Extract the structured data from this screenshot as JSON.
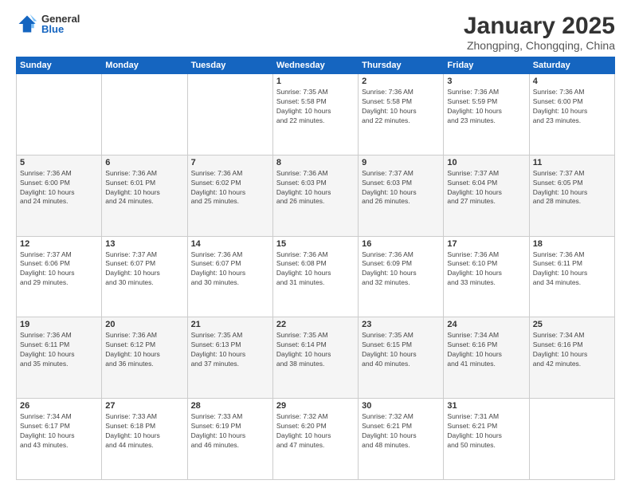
{
  "logo": {
    "general": "General",
    "blue": "Blue"
  },
  "title": "January 2025",
  "subtitle": "Zhongping, Chongqing, China",
  "days_of_week": [
    "Sunday",
    "Monday",
    "Tuesday",
    "Wednesday",
    "Thursday",
    "Friday",
    "Saturday"
  ],
  "weeks": [
    [
      {
        "day": "",
        "info": ""
      },
      {
        "day": "",
        "info": ""
      },
      {
        "day": "",
        "info": ""
      },
      {
        "day": "1",
        "info": "Sunrise: 7:35 AM\nSunset: 5:58 PM\nDaylight: 10 hours\nand 22 minutes."
      },
      {
        "day": "2",
        "info": "Sunrise: 7:36 AM\nSunset: 5:58 PM\nDaylight: 10 hours\nand 22 minutes."
      },
      {
        "day": "3",
        "info": "Sunrise: 7:36 AM\nSunset: 5:59 PM\nDaylight: 10 hours\nand 23 minutes."
      },
      {
        "day": "4",
        "info": "Sunrise: 7:36 AM\nSunset: 6:00 PM\nDaylight: 10 hours\nand 23 minutes."
      }
    ],
    [
      {
        "day": "5",
        "info": "Sunrise: 7:36 AM\nSunset: 6:00 PM\nDaylight: 10 hours\nand 24 minutes."
      },
      {
        "day": "6",
        "info": "Sunrise: 7:36 AM\nSunset: 6:01 PM\nDaylight: 10 hours\nand 24 minutes."
      },
      {
        "day": "7",
        "info": "Sunrise: 7:36 AM\nSunset: 6:02 PM\nDaylight: 10 hours\nand 25 minutes."
      },
      {
        "day": "8",
        "info": "Sunrise: 7:36 AM\nSunset: 6:03 PM\nDaylight: 10 hours\nand 26 minutes."
      },
      {
        "day": "9",
        "info": "Sunrise: 7:37 AM\nSunset: 6:03 PM\nDaylight: 10 hours\nand 26 minutes."
      },
      {
        "day": "10",
        "info": "Sunrise: 7:37 AM\nSunset: 6:04 PM\nDaylight: 10 hours\nand 27 minutes."
      },
      {
        "day": "11",
        "info": "Sunrise: 7:37 AM\nSunset: 6:05 PM\nDaylight: 10 hours\nand 28 minutes."
      }
    ],
    [
      {
        "day": "12",
        "info": "Sunrise: 7:37 AM\nSunset: 6:06 PM\nDaylight: 10 hours\nand 29 minutes."
      },
      {
        "day": "13",
        "info": "Sunrise: 7:37 AM\nSunset: 6:07 PM\nDaylight: 10 hours\nand 30 minutes."
      },
      {
        "day": "14",
        "info": "Sunrise: 7:36 AM\nSunset: 6:07 PM\nDaylight: 10 hours\nand 30 minutes."
      },
      {
        "day": "15",
        "info": "Sunrise: 7:36 AM\nSunset: 6:08 PM\nDaylight: 10 hours\nand 31 minutes."
      },
      {
        "day": "16",
        "info": "Sunrise: 7:36 AM\nSunset: 6:09 PM\nDaylight: 10 hours\nand 32 minutes."
      },
      {
        "day": "17",
        "info": "Sunrise: 7:36 AM\nSunset: 6:10 PM\nDaylight: 10 hours\nand 33 minutes."
      },
      {
        "day": "18",
        "info": "Sunrise: 7:36 AM\nSunset: 6:11 PM\nDaylight: 10 hours\nand 34 minutes."
      }
    ],
    [
      {
        "day": "19",
        "info": "Sunrise: 7:36 AM\nSunset: 6:11 PM\nDaylight: 10 hours\nand 35 minutes."
      },
      {
        "day": "20",
        "info": "Sunrise: 7:36 AM\nSunset: 6:12 PM\nDaylight: 10 hours\nand 36 minutes."
      },
      {
        "day": "21",
        "info": "Sunrise: 7:35 AM\nSunset: 6:13 PM\nDaylight: 10 hours\nand 37 minutes."
      },
      {
        "day": "22",
        "info": "Sunrise: 7:35 AM\nSunset: 6:14 PM\nDaylight: 10 hours\nand 38 minutes."
      },
      {
        "day": "23",
        "info": "Sunrise: 7:35 AM\nSunset: 6:15 PM\nDaylight: 10 hours\nand 40 minutes."
      },
      {
        "day": "24",
        "info": "Sunrise: 7:34 AM\nSunset: 6:16 PM\nDaylight: 10 hours\nand 41 minutes."
      },
      {
        "day": "25",
        "info": "Sunrise: 7:34 AM\nSunset: 6:16 PM\nDaylight: 10 hours\nand 42 minutes."
      }
    ],
    [
      {
        "day": "26",
        "info": "Sunrise: 7:34 AM\nSunset: 6:17 PM\nDaylight: 10 hours\nand 43 minutes."
      },
      {
        "day": "27",
        "info": "Sunrise: 7:33 AM\nSunset: 6:18 PM\nDaylight: 10 hours\nand 44 minutes."
      },
      {
        "day": "28",
        "info": "Sunrise: 7:33 AM\nSunset: 6:19 PM\nDaylight: 10 hours\nand 46 minutes."
      },
      {
        "day": "29",
        "info": "Sunrise: 7:32 AM\nSunset: 6:20 PM\nDaylight: 10 hours\nand 47 minutes."
      },
      {
        "day": "30",
        "info": "Sunrise: 7:32 AM\nSunset: 6:21 PM\nDaylight: 10 hours\nand 48 minutes."
      },
      {
        "day": "31",
        "info": "Sunrise: 7:31 AM\nSunset: 6:21 PM\nDaylight: 10 hours\nand 50 minutes."
      },
      {
        "day": "",
        "info": ""
      }
    ]
  ]
}
